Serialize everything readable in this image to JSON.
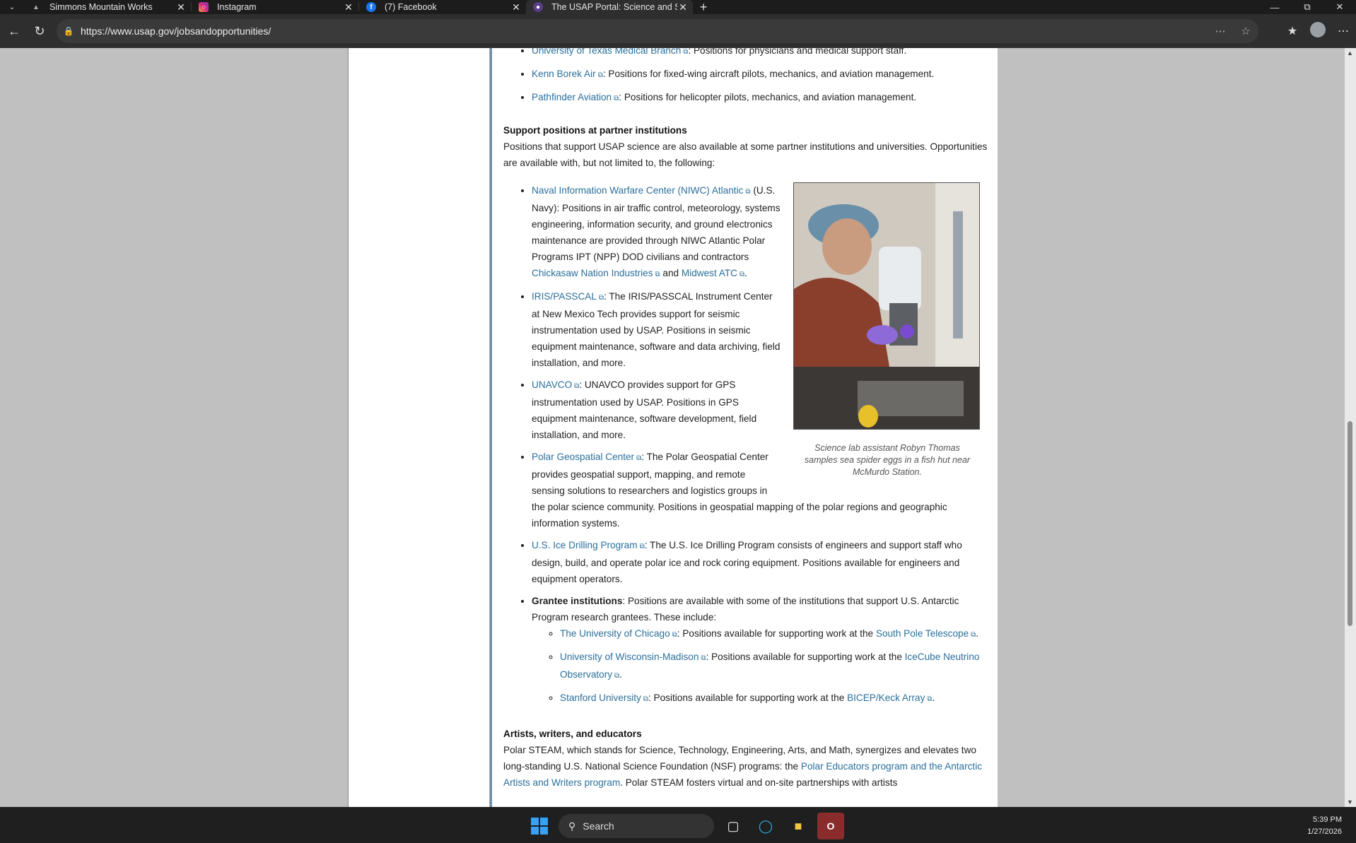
{
  "browser": {
    "tabs": [
      {
        "title": "Simmons Mountain Works",
        "favicon": "mountain-icon",
        "active": false
      },
      {
        "title": "Instagram",
        "favicon": "instagram-icon",
        "active": false
      },
      {
        "title": "(7) Facebook",
        "favicon": "facebook-icon",
        "active": false
      },
      {
        "title": "The USAP Portal: Science and Sup",
        "favicon": "usap-icon",
        "active": true
      }
    ],
    "url": "https://www.usap.gov/jobsandopportunities/"
  },
  "page": {
    "top_list": [
      {
        "link": "University of Texas Medical Branch",
        "text": ": Positions for physicians and medical support staff."
      },
      {
        "link": "Kenn Borek Air",
        "text": ": Positions for fixed-wing aircraft pilots, mechanics, and aviation management."
      },
      {
        "link": "Pathfinder Aviation",
        "text": ": Positions for helicopter pilots, mechanics, and aviation management."
      }
    ],
    "support_heading": "Support positions at partner institutions",
    "support_intro": "Positions that support USAP science are also available at some partner institutions and universities. Opportunities are available with, but not limited to, the following:",
    "figure_caption": "Science lab assistant Robyn Thomas samples sea spider eggs in a fish hut near McMurdo Station.",
    "partners": {
      "niwc_link": "Naval Information Warfare Center (NIWC) Atlantic",
      "niwc_text": " (U.S. Navy): Positions in air traffic control, meteorology, systems engineering, information security, and ground electronics maintenance are provided through NIWC Atlantic Polar Programs IPT (NPP) DOD civilians and contractors ",
      "chickasaw_link": "Chickasaw Nation Industries",
      "and_text": " and ",
      "midwest_link": "Midwest ATC",
      "period": ".",
      "iris_link": "IRIS/PASSCAL",
      "iris_text": ": The IRIS/PASSCAL Instrument Center at New Mexico Tech provides support for seismic instrumentation used by USAP. Positions in seismic equipment maintenance, software and data archiving, field installation, and more.",
      "unavco_link": "UNAVCO",
      "unavco_text": ": UNAVCO provides support for GPS instrumentation used by USAP. Positions in GPS equipment maintenance, software development, field installation, and more.",
      "pgc_link": "Polar Geospatial Center",
      "pgc_text": ": The Polar Geospatial Center provides geospatial support, mapping, and remote sensing solutions to researchers and logistics groups in the polar science community. Positions in geospatial mapping of the polar regions and geographic information systems.",
      "ice_link": "U.S. Ice Drilling Program",
      "ice_text": ": The U.S. Ice Drilling Program consists of engineers and support staff who design, build, and operate polar ice and rock coring equipment. Positions available for engineers and equipment operators.",
      "grantee_label": "Grantee institutions",
      "grantee_text": ": Positions are available with some of the institutions that support U.S. Antarctic Program research grantees. These include:"
    },
    "grantees": {
      "uchicago_link": "The University of Chicago",
      "uchicago_text": ": Positions available for supporting work at the ",
      "spt_link": "South Pole Telescope",
      "uw_link": "University of Wisconsin-Madison",
      "uw_text": ": Positions available for supporting work at the ",
      "icecube_link": "IceCube Neutrino Observatory",
      "stanford_link": "Stanford University",
      "stanford_text": ": Positions available for supporting work at the ",
      "bicep_link": "BICEP/Keck Array",
      "period": "."
    },
    "artists_heading": "Artists, writers, and educators",
    "artists_text": "Polar STEAM, which stands for Science, Technology, Engineering, Arts, and Math, synergizes and elevates two long-standing U.S. National Science Foundation (NSF) programs: the ",
    "artists_link": "Polar Educators program and the Antarctic Artists and Writers program",
    "artists_tail": ". Polar STEAM fosters virtual and on-site partnerships with artists"
  },
  "taskbar": {
    "search_label": "Search",
    "time": "5:39 PM",
    "date": "1/27/2026"
  }
}
